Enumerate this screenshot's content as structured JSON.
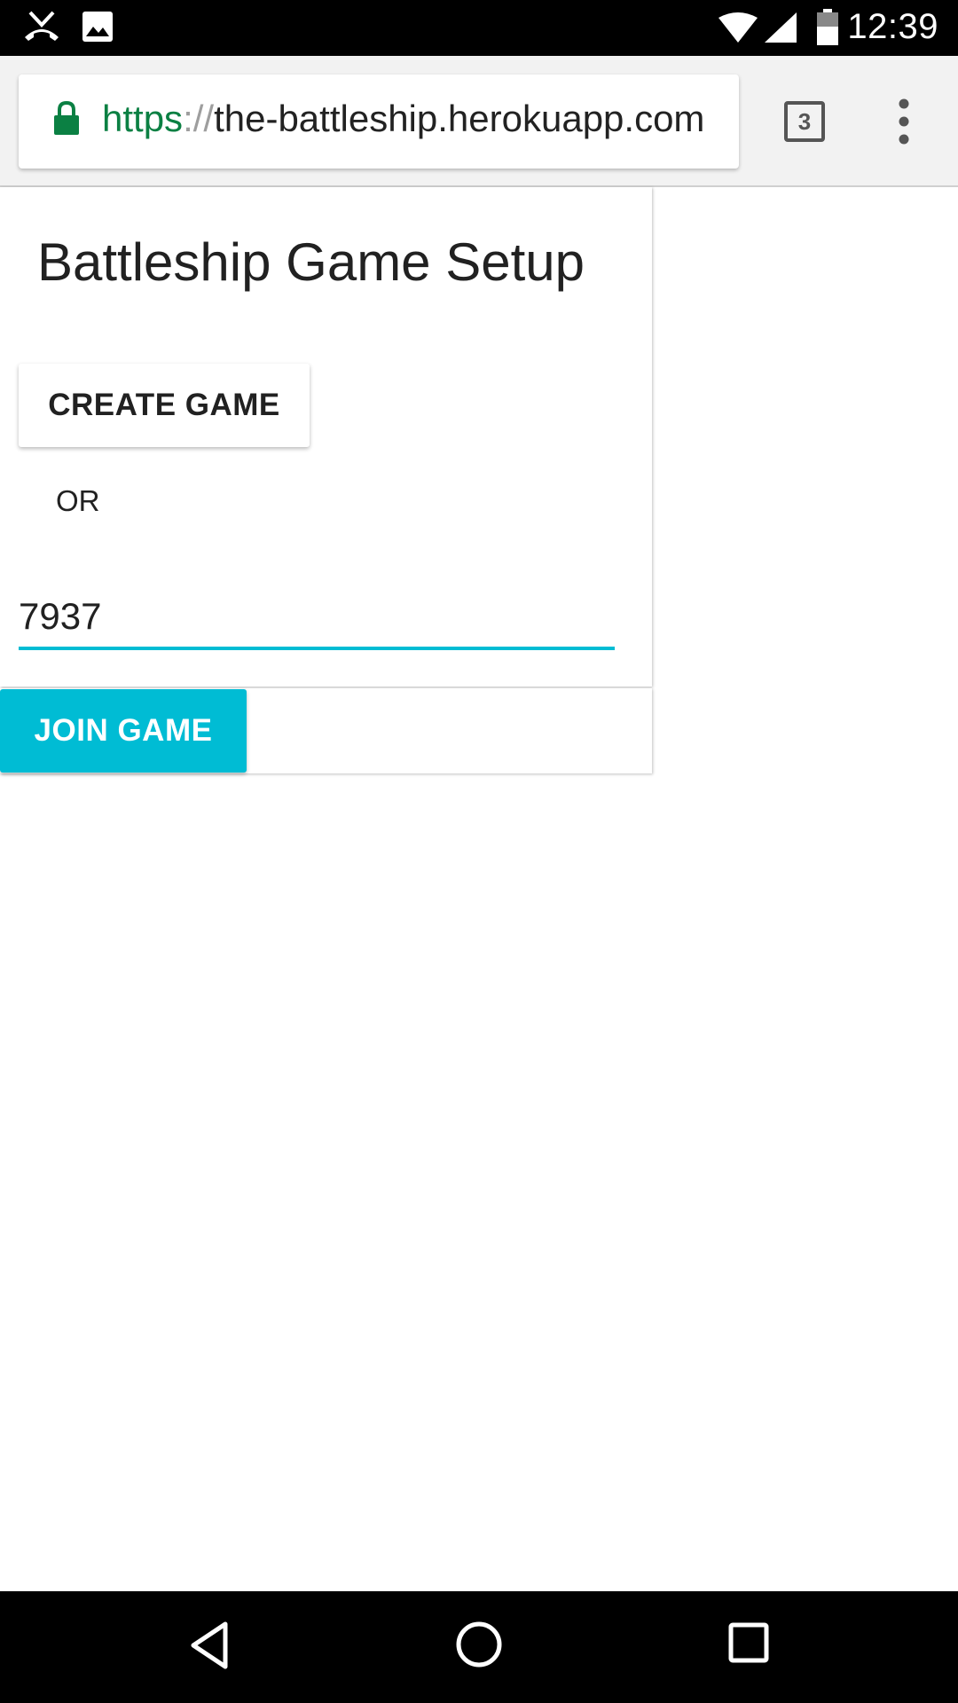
{
  "status_bar": {
    "time": "12:39",
    "icons": [
      "missed-call-icon",
      "image-icon",
      "wifi-icon",
      "signal-icon",
      "battery-icon"
    ]
  },
  "browser": {
    "url_scheme": "https",
    "url_separator": "://",
    "url_host": "the-battleship.herokuapp.com",
    "tab_count": "3",
    "secure_color": "#0b8043"
  },
  "page": {
    "title": "Battleship Game Setup",
    "create_button_label": "CREATE GAME",
    "or_label": "OR",
    "game_code_value": "7937",
    "join_button_label": "JOIN GAME",
    "accent_color": "#00bcd4"
  },
  "nav_bar": {
    "buttons": [
      "back-icon",
      "home-icon",
      "recents-icon"
    ]
  }
}
